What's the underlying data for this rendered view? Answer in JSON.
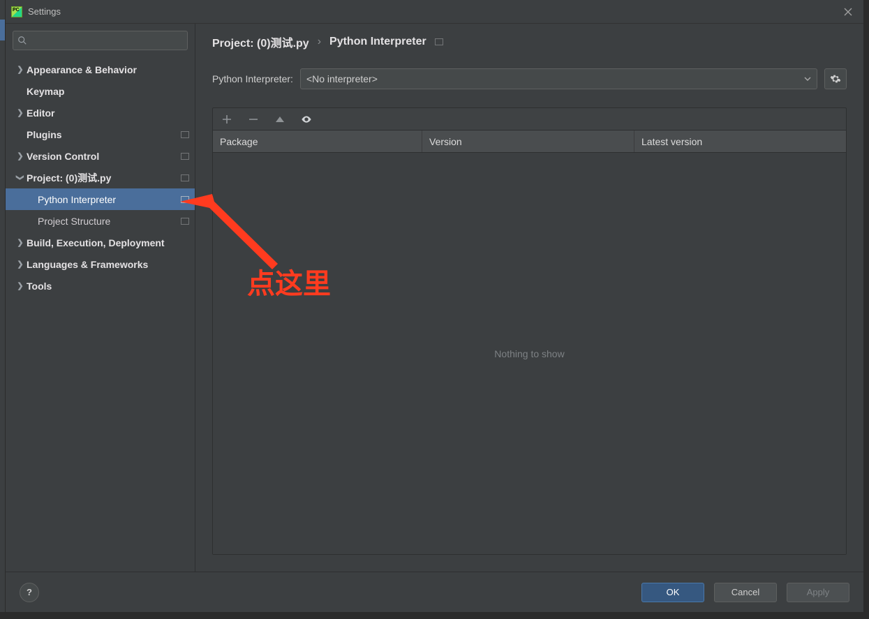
{
  "window": {
    "title": "Settings"
  },
  "sidebar": {
    "search_placeholder": "",
    "items": [
      {
        "label": "Appearance & Behavior",
        "expandable": true,
        "bold": true
      },
      {
        "label": "Keymap",
        "expandable": false,
        "bold": true
      },
      {
        "label": "Editor",
        "expandable": true,
        "bold": true
      },
      {
        "label": "Plugins",
        "expandable": false,
        "bold": true,
        "badge": true
      },
      {
        "label": "Version Control",
        "expandable": true,
        "bold": true,
        "badge": true
      },
      {
        "label": "Project: (0)测试.py",
        "expandable": true,
        "expanded": true,
        "bold": true,
        "badge": true
      },
      {
        "label": "Python Interpreter",
        "child": true,
        "selected": true,
        "badge": true
      },
      {
        "label": "Project Structure",
        "child": true,
        "badge": true
      },
      {
        "label": "Build, Execution, Deployment",
        "expandable": true,
        "bold": true
      },
      {
        "label": "Languages & Frameworks",
        "expandable": true,
        "bold": true
      },
      {
        "label": "Tools",
        "expandable": true,
        "bold": true
      }
    ]
  },
  "breadcrumb": {
    "root": "Project: (0)测试.py",
    "sep": "›",
    "leaf": "Python Interpreter"
  },
  "interpreter": {
    "label": "Python Interpreter:",
    "value": "<No interpreter>"
  },
  "packages": {
    "columns": {
      "package": "Package",
      "version": "Version",
      "latest": "Latest version"
    },
    "empty_text": "Nothing to show"
  },
  "footer": {
    "ok": "OK",
    "cancel": "Cancel",
    "apply": "Apply"
  },
  "annotation": {
    "text": "点这里"
  }
}
